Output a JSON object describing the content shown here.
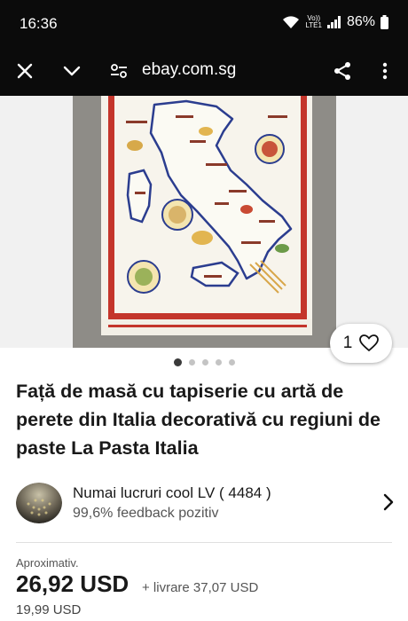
{
  "status": {
    "time": "16:36",
    "battery": "86%",
    "volte_line1": "Vo))",
    "volte_line2": "LTE1"
  },
  "browser": {
    "domain": "ebay.com.sg"
  },
  "gallery": {
    "favorite_count": "1",
    "total_images": 5,
    "active_image": 1
  },
  "listing": {
    "title": "Față de masă cu tapiserie cu artă de perete din Italia decorativă cu regiuni de paste La Pasta Italia"
  },
  "seller": {
    "name": "Numai lucruri cool LV ( 4484 )",
    "feedback": "99,6% feedback pozitiv"
  },
  "pricing": {
    "approx_label": "Aproximativ.",
    "price": "26,92 USD",
    "shipping": "+ livrare 37,07 USD",
    "original_price": "19,99 USD"
  }
}
